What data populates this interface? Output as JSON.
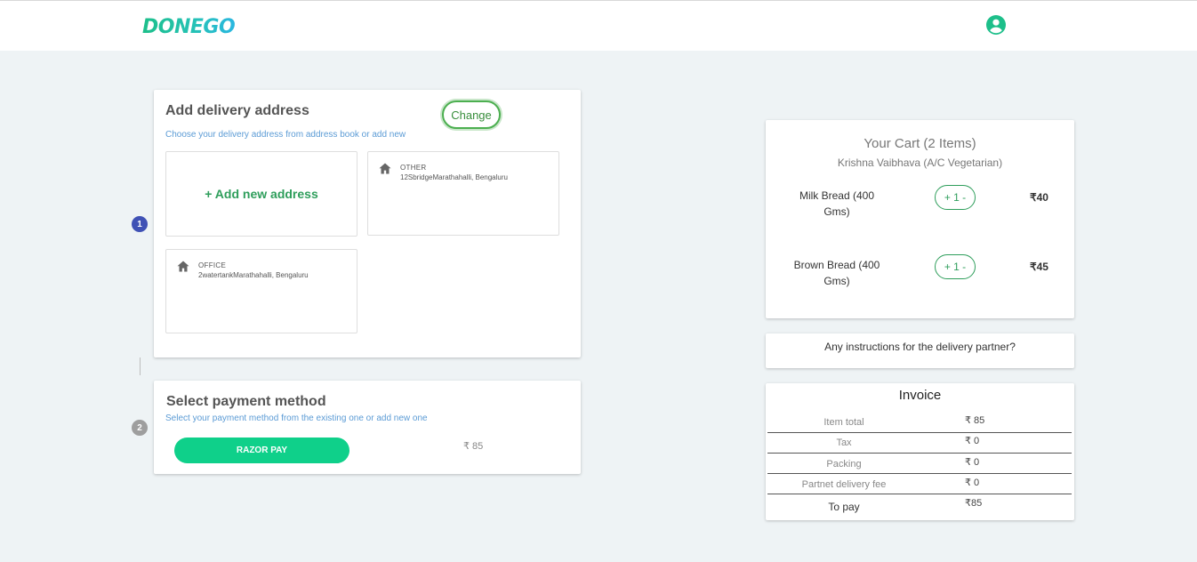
{
  "header": {
    "logo_text": "DONEGO",
    "user_icon": "account-circle-icon",
    "brand_color": "#1dbf8a"
  },
  "steps": [
    "1",
    "2"
  ],
  "address": {
    "title": "Add delivery address",
    "change_label": "Change",
    "subtitle": "Choose your delivery address from address book or add new",
    "add_new_label": "+ Add new address",
    "items": [
      {
        "type": "OTHER",
        "line": "12SbridgeMarathahalli, Bengaluru",
        "icon": "home-icon"
      },
      {
        "type": "OFFICE",
        "line": "2watertankMarathahalli, Bengaluru",
        "icon": "home-icon"
      }
    ]
  },
  "payment": {
    "title": "Select payment method",
    "subtitle": "Select your payment method from the existing one or add new one",
    "razor_label": "RAZOR PAY",
    "amount": "₹ 85",
    "button_color": "#0fd08a"
  },
  "cart": {
    "title": "Your Cart (2 Items)",
    "restaurant": "Krishna Vaibhava (A/C Vegetarian)",
    "items": [
      {
        "name": "Milk Bread (400 Gms)",
        "qty": "+ 1 -",
        "price": "₹40"
      },
      {
        "name": "Brown Bread (400 Gms)",
        "qty": "+ 1 -",
        "price": "₹45"
      }
    ]
  },
  "instructions": {
    "placeholder": "Any instructions for the delivery partner?"
  },
  "invoice": {
    "title": "Invoice",
    "rows": [
      {
        "label": "Item total",
        "value": "₹ 85"
      },
      {
        "label": "Tax",
        "value": "₹ 0"
      },
      {
        "label": "Packing",
        "value": "₹ 0"
      },
      {
        "label": "Partnet delivery fee",
        "value": "₹ 0"
      },
      {
        "label": "To pay",
        "value": "₹85"
      }
    ]
  }
}
